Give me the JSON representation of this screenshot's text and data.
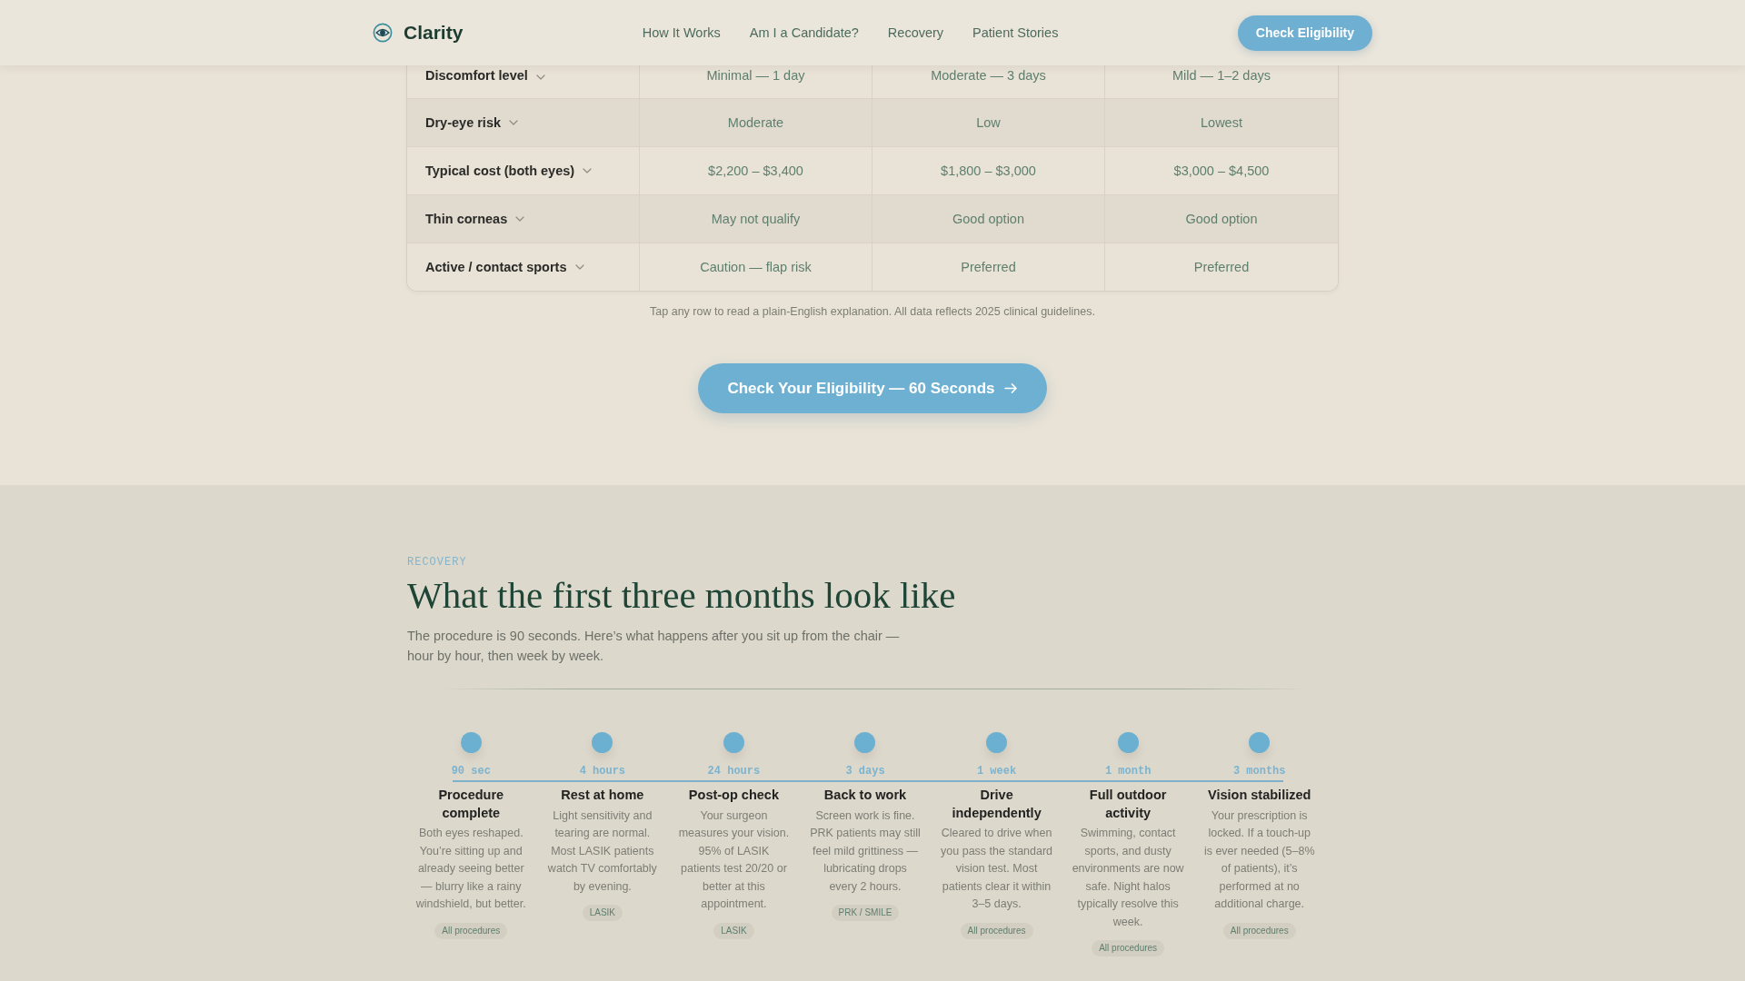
{
  "header": {
    "logo": "Clarity",
    "nav_links": [
      "How It Works",
      "Am I a Candidate?",
      "Recovery",
      "Patient Stories"
    ],
    "cta": "Check Eligibility"
  },
  "comparison_table": {
    "rows": [
      {
        "label": "Discomfort level",
        "expanded": false,
        "cells": [
          "Minimal — 1 day",
          "Moderate — 3 days",
          "Mild — 1–2 days"
        ]
      },
      {
        "label": "Dry-eye risk",
        "expanded": false,
        "cells": [
          "Moderate",
          "Low",
          "Lowest"
        ]
      },
      {
        "label": "Typical cost (both eyes)",
        "expanded": false,
        "cells": [
          "$2,200 – $3,400",
          "$1,800 – $3,000",
          "$3,000 – $4,500"
        ]
      },
      {
        "label": "Thin corneas",
        "expanded": false,
        "cells": [
          "May not qualify",
          "Good option",
          "Good option"
        ]
      },
      {
        "label": "Active / contact sports",
        "expanded": false,
        "cells": [
          "Caution — flap risk",
          "Preferred",
          "Preferred"
        ]
      }
    ]
  },
  "table_note": "Tap any row to read a plain-English explanation. All data reflects 2025 clinical guidelines.",
  "cta_button": "Check Your Eligibility — 60 Seconds",
  "recovery": {
    "eyebrow": "RECOVERY",
    "title": "What the first three months look like",
    "intro": "The procedure is 90 seconds. Here’s what happens after you sit up from the chair — hour by hour, then week by week.",
    "milestones": [
      {
        "time": "90 sec",
        "title": "Procedure complete",
        "text": "Both eyes reshaped. You’re sitting up and already seeing better — blurry like a rainy windshield, but better.",
        "tag": "All procedures"
      },
      {
        "time": "4 hours",
        "title": "Rest at home",
        "text": "Light sensitivity and tearing are normal. Most LASIK patients watch TV comfortably by evening.",
        "tag": "LASIK"
      },
      {
        "time": "24 hours",
        "title": "Post-op check",
        "text": "Your surgeon measures your vision. 95% of LASIK patients test 20/20 or better at this appointment.",
        "tag": "LASIK"
      },
      {
        "time": "3 days",
        "title": "Back to work",
        "text": "Screen work is fine. PRK patients may still feel mild grittiness — lubricating drops every 2 hours.",
        "tag": "PRK / SMILE"
      },
      {
        "time": "1 week",
        "title": "Drive independently",
        "text": "Cleared to drive when you pass the standard vision test. Most patients clear it within 3–5 days.",
        "tag": "All procedures"
      },
      {
        "time": "1 month",
        "title": "Full outdoor activity",
        "text": "Swimming, contact sports, and dusty environments are now safe. Night halos typically resolve this week.",
        "tag": "All procedures"
      },
      {
        "time": "3 months",
        "title": "Vision stabilized",
        "text": "Your prescription is locked. If a touch-up is ever needed (5–8% of patients), it’s performed at no additional charge.",
        "tag": "All procedures"
      }
    ]
  }
}
